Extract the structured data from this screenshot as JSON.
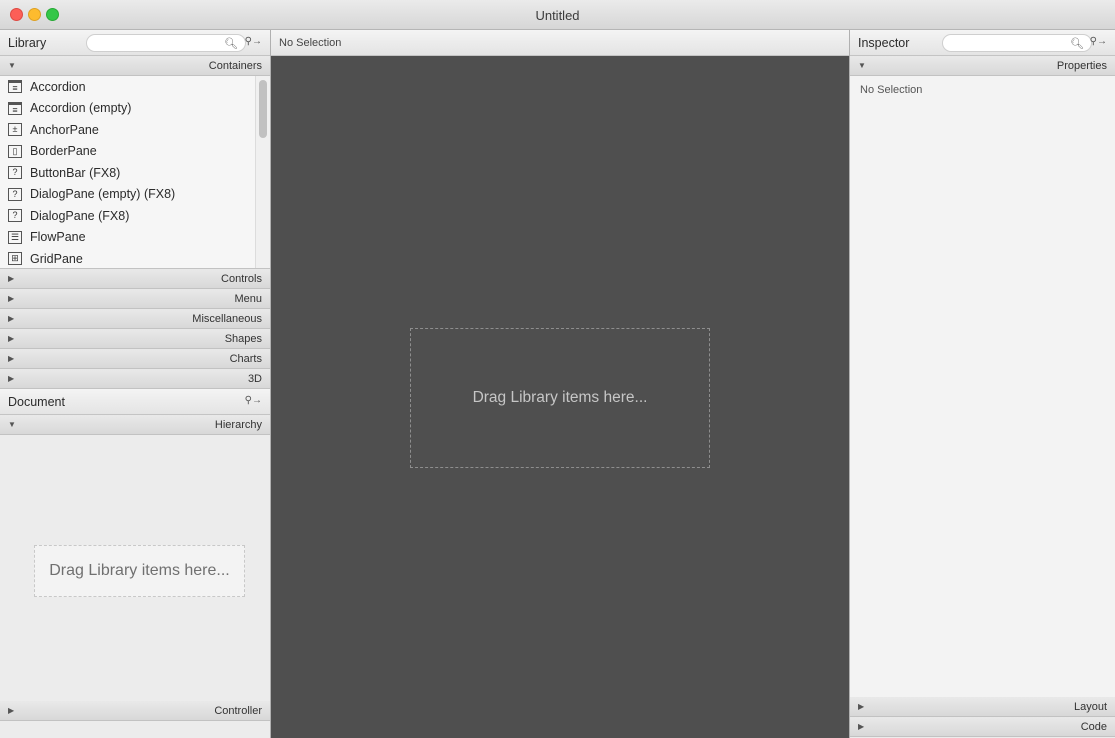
{
  "window": {
    "title": "Untitled"
  },
  "library": {
    "title": "Library",
    "sections": {
      "containers": "Containers",
      "controls": "Controls",
      "menu": "Menu",
      "miscellaneous": "Miscellaneous",
      "shapes": "Shapes",
      "charts": "Charts",
      "three_d": "3D"
    },
    "items": [
      {
        "label": "Accordion",
        "icon": "accordion-icon"
      },
      {
        "label": "Accordion  (empty)",
        "icon": "accordion-icon"
      },
      {
        "label": "AnchorPane",
        "icon": "anchorpane-icon"
      },
      {
        "label": "BorderPane",
        "icon": "borderpane-icon"
      },
      {
        "label": "ButtonBar  (FX8)",
        "icon": "unknown-component-icon"
      },
      {
        "label": "DialogPane (empty)  (FX8)",
        "icon": "unknown-component-icon"
      },
      {
        "label": "DialogPane  (FX8)",
        "icon": "unknown-component-icon"
      },
      {
        "label": "FlowPane",
        "icon": "flowpane-icon"
      },
      {
        "label": "GridPane",
        "icon": "gridpane-icon"
      }
    ]
  },
  "document": {
    "title": "Document",
    "hierarchy_label": "Hierarchy",
    "drop_hint": "Drag Library items here...",
    "controller_label": "Controller"
  },
  "content": {
    "selection": "No Selection",
    "drop_hint": "Drag Library items here..."
  },
  "inspector": {
    "title": "Inspector",
    "properties_label": "Properties",
    "selection": "No Selection",
    "layout_label": "Layout",
    "code_label": "Code"
  }
}
